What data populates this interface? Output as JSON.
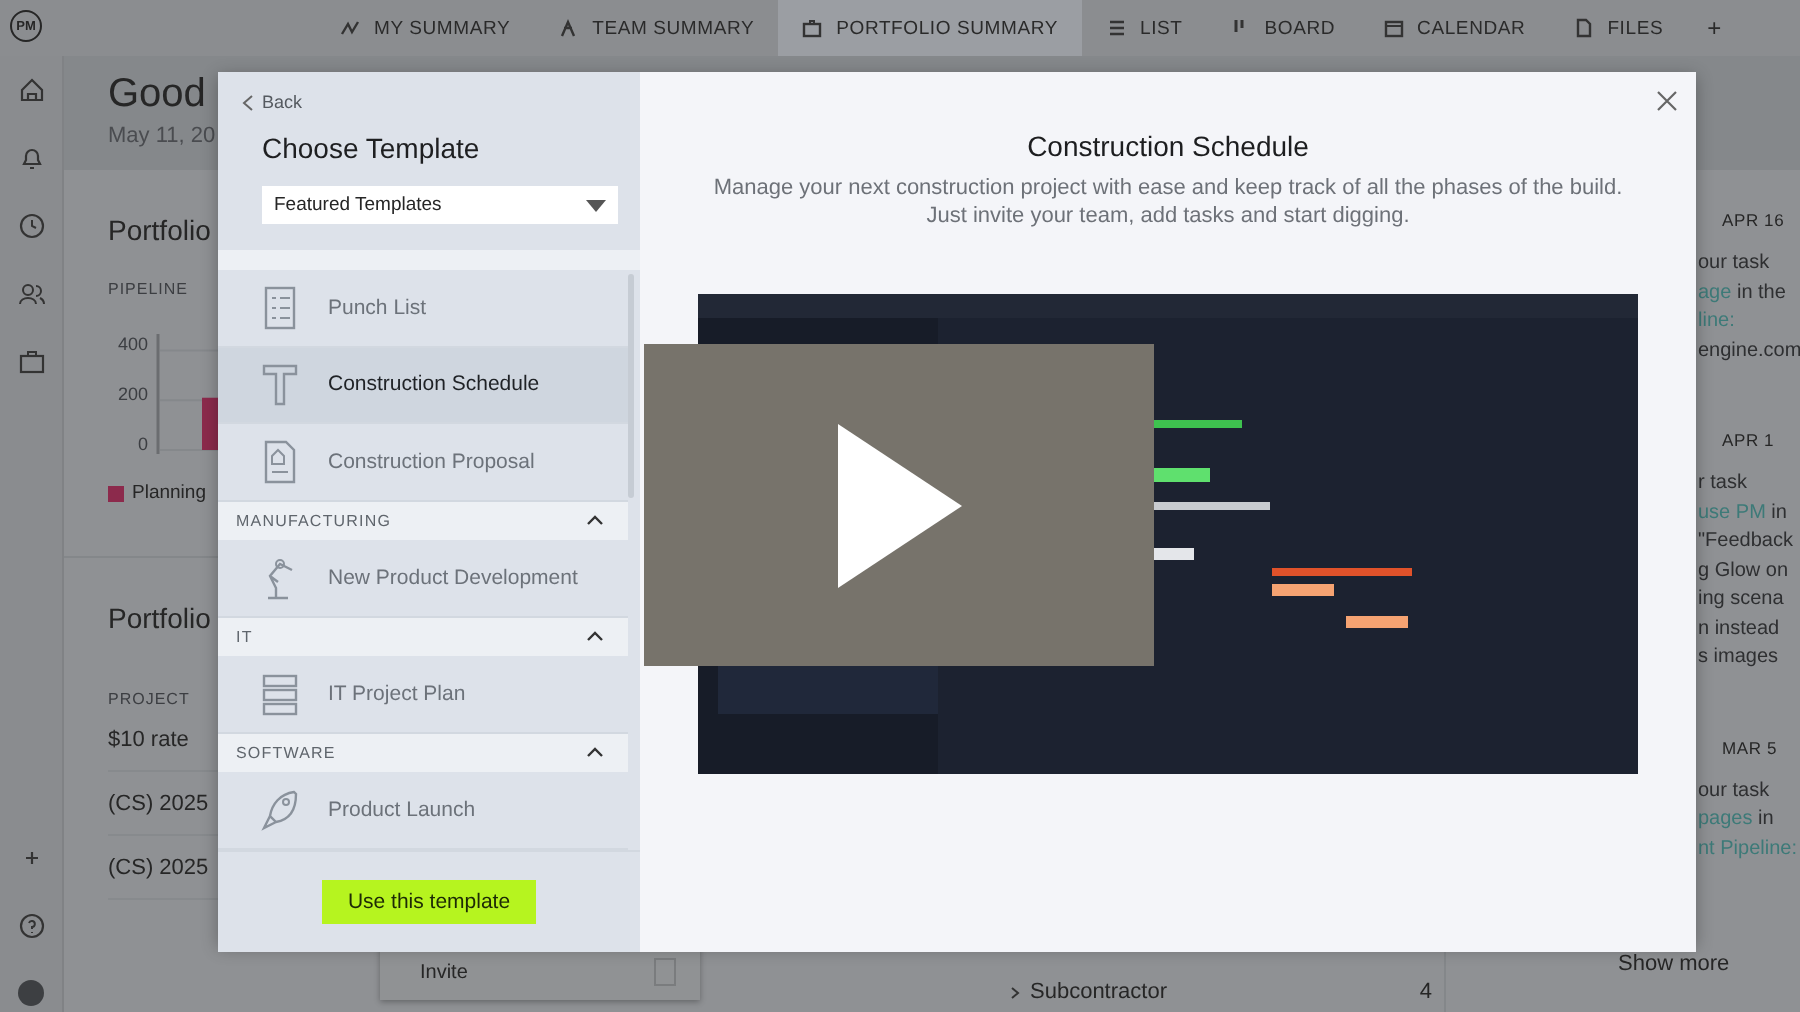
{
  "nav": {
    "logo": "PM",
    "tabs": [
      {
        "label": "MY SUMMARY",
        "selected": false
      },
      {
        "label": "TEAM SUMMARY",
        "selected": false
      },
      {
        "label": "PORTFOLIO SUMMARY",
        "selected": true
      },
      {
        "label": "LIST",
        "selected": false
      },
      {
        "label": "BOARD",
        "selected": false
      },
      {
        "label": "CALENDAR",
        "selected": false
      },
      {
        "label": "FILES",
        "selected": false
      }
    ],
    "add": "+"
  },
  "header": {
    "greeting": "Good",
    "date": "May 11, 20"
  },
  "pipeline": {
    "title": "Portfolio",
    "label": "PIPELINE",
    "chart_data": {
      "type": "bar",
      "yticks": [
        0,
        200,
        400
      ],
      "ylim": [
        0,
        450
      ],
      "series": [
        {
          "name": "Planning",
          "color": "#8c2a4c",
          "values": [
            210
          ]
        }
      ]
    }
  },
  "projects": {
    "title": "Portfolio",
    "column": "PROJECT",
    "rows": [
      "$10 rate",
      "(CS) 2025",
      "(CS) 2025"
    ]
  },
  "invite": {
    "label": "Invite"
  },
  "subcontractor": {
    "label": "Subcontractor",
    "count": "4"
  },
  "activity": [
    {
      "date": "APR 16",
      "lines": [
        {
          "text": "our task"
        },
        {
          "link": "age",
          "text": " in the"
        },
        {
          "link": "line:"
        },
        {
          "text": "engine.com"
        }
      ]
    },
    {
      "date": "APR 1",
      "lines": [
        {
          "text": "r task"
        },
        {
          "link": "use PM",
          "text": " in"
        },
        {
          "text": "\"Feedback"
        },
        {
          "text": "g Glow on"
        },
        {
          "text": "ing scena"
        },
        {
          "text": "n instead"
        },
        {
          "text": "s images"
        }
      ]
    },
    {
      "date": "MAR 5",
      "lines": [
        {
          "text": "our task"
        },
        {
          "link": "pages",
          "text": " in"
        },
        {
          "link": "nt Pipeline:"
        }
      ]
    }
  ],
  "show_more": "Show more",
  "modal": {
    "back": "Back",
    "title": "Choose Template",
    "dropdown": {
      "value": "Featured Templates"
    },
    "groups": [
      {
        "items": [
          {
            "label": "Punch List",
            "selected": false
          },
          {
            "label": "Construction Schedule",
            "selected": true
          },
          {
            "label": "Construction Proposal",
            "selected": false
          }
        ]
      },
      {
        "header": "MANUFACTURING",
        "expanded": true,
        "items": [
          {
            "label": "New Product Development",
            "selected": false
          }
        ]
      },
      {
        "header": "IT",
        "expanded": true,
        "items": [
          {
            "label": "IT Project Plan",
            "selected": false
          }
        ]
      },
      {
        "header": "SOFTWARE",
        "expanded": true,
        "items": [
          {
            "label": "Product Launch",
            "selected": false
          }
        ]
      }
    ],
    "use_button": "Use this template",
    "preview": {
      "title": "Construction Schedule",
      "description": "Manage your next construction project with ease and keep track of all the phases of the build. Just invite your team, add tasks and start digging."
    }
  }
}
